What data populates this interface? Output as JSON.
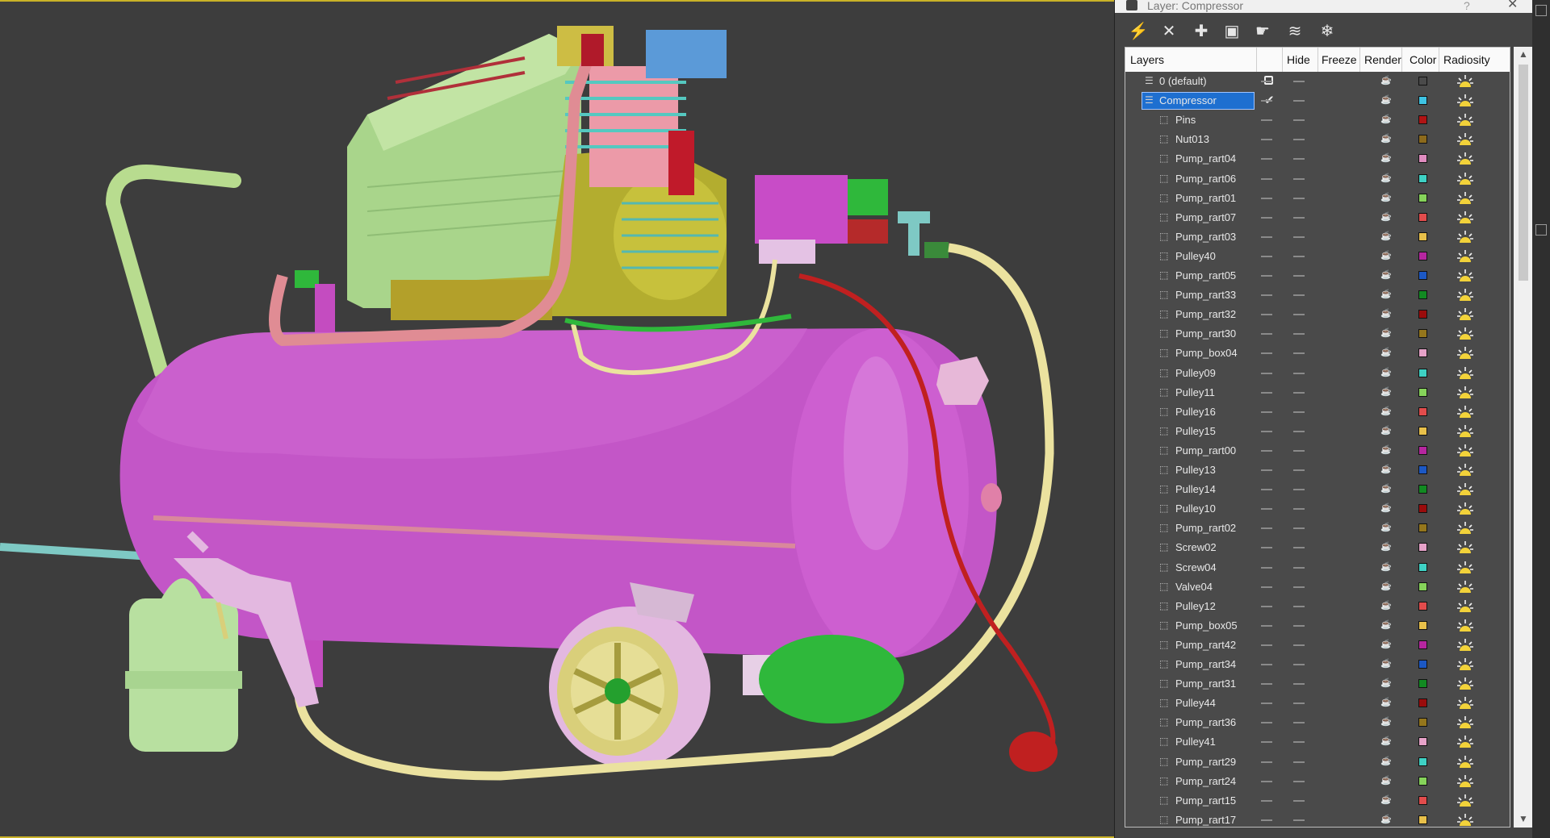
{
  "panel": {
    "title": "Layer: Compressor",
    "help": "?",
    "close": "✕"
  },
  "toolbar": [
    {
      "name": "create-layer-button",
      "icon": "layers-star-icon",
      "glyph": "⚡"
    },
    {
      "name": "delete-layer-button",
      "icon": "close-x-icon",
      "glyph": "✕"
    },
    {
      "name": "add-to-layer-button",
      "icon": "plus-icon",
      "glyph": "✚"
    },
    {
      "name": "select-objects-button",
      "icon": "select-cursor-icon",
      "glyph": "▣"
    },
    {
      "name": "highlight-layer-button",
      "icon": "hand-select-icon",
      "glyph": "☛"
    },
    {
      "name": "hide-all-button",
      "icon": "layers-hide-icon",
      "glyph": "≋"
    },
    {
      "name": "freeze-all-button",
      "icon": "layers-freeze-icon",
      "glyph": "❄"
    }
  ],
  "columns": [
    "Layers",
    "Hide",
    "Freeze",
    "Render",
    "Color",
    "Radiosity"
  ],
  "layers": [
    {
      "name": "0 (default)",
      "type": "layer",
      "color": "#4a4a4a",
      "current": true
    },
    {
      "name": "Compressor",
      "type": "layer",
      "color": "#3ec3e3",
      "selected": true,
      "active": true
    },
    {
      "name": "Pins",
      "type": "object",
      "color": "#b01414"
    },
    {
      "name": "Nut013",
      "type": "object",
      "color": "#8c6a1c"
    },
    {
      "name": "Pump_rart04",
      "type": "object",
      "color": "#e08cc0"
    },
    {
      "name": "Pump_rart06",
      "type": "object",
      "color": "#3ed1c4"
    },
    {
      "name": "Pump_rart01",
      "type": "object",
      "color": "#86d35a"
    },
    {
      "name": "Pump_rart07",
      "type": "object",
      "color": "#e24c4c"
    },
    {
      "name": "Pump_rart03",
      "type": "object",
      "color": "#e8c04a"
    },
    {
      "name": "Pulley40",
      "type": "object",
      "color": "#b626a0"
    },
    {
      "name": "Pump_rart05",
      "type": "object",
      "color": "#1c58c4"
    },
    {
      "name": "Pump_rart33",
      "type": "object",
      "color": "#128a22"
    },
    {
      "name": "Pump_rart32",
      "type": "object",
      "color": "#9a0c0c"
    },
    {
      "name": "Pump_rart30",
      "type": "object",
      "color": "#94761c"
    },
    {
      "name": "Pump_box04",
      "type": "object",
      "color": "#e6a2c8"
    },
    {
      "name": "Pulley09",
      "type": "object",
      "color": "#3ed1c4"
    },
    {
      "name": "Pulley11",
      "type": "object",
      "color": "#86d35a"
    },
    {
      "name": "Pulley16",
      "type": "object",
      "color": "#e24c4c"
    },
    {
      "name": "Pulley15",
      "type": "object",
      "color": "#e8c04a"
    },
    {
      "name": "Pump_rart00",
      "type": "object",
      "color": "#b626a0"
    },
    {
      "name": "Pulley13",
      "type": "object",
      "color": "#1c58c4"
    },
    {
      "name": "Pulley14",
      "type": "object",
      "color": "#128a22"
    },
    {
      "name": "Pulley10",
      "type": "object",
      "color": "#9a0c0c"
    },
    {
      "name": "Pump_rart02",
      "type": "object",
      "color": "#94761c"
    },
    {
      "name": "Screw02",
      "type": "object",
      "color": "#e6a2c8"
    },
    {
      "name": "Screw04",
      "type": "object",
      "color": "#3ed1c4"
    },
    {
      "name": "Valve04",
      "type": "object",
      "color": "#86d35a"
    },
    {
      "name": "Pulley12",
      "type": "object",
      "color": "#e24c4c"
    },
    {
      "name": "Pump_box05",
      "type": "object",
      "color": "#e8c04a"
    },
    {
      "name": "Pump_rart42",
      "type": "object",
      "color": "#b626a0"
    },
    {
      "name": "Pump_rart34",
      "type": "object",
      "color": "#1c58c4"
    },
    {
      "name": "Pump_rart31",
      "type": "object",
      "color": "#128a22"
    },
    {
      "name": "Pulley44",
      "type": "object",
      "color": "#9a0c0c"
    },
    {
      "name": "Pump_rart36",
      "type": "object",
      "color": "#94761c"
    },
    {
      "name": "Pulley41",
      "type": "object",
      "color": "#e6a2c8"
    },
    {
      "name": "Pump_rart29",
      "type": "object",
      "color": "#3ed1c4"
    },
    {
      "name": "Pump_rart24",
      "type": "object",
      "color": "#86d35a"
    },
    {
      "name": "Pump_rart15",
      "type": "object",
      "color": "#e24c4c"
    },
    {
      "name": "Pump_rart17",
      "type": "object",
      "color": "#e8c04a"
    }
  ]
}
